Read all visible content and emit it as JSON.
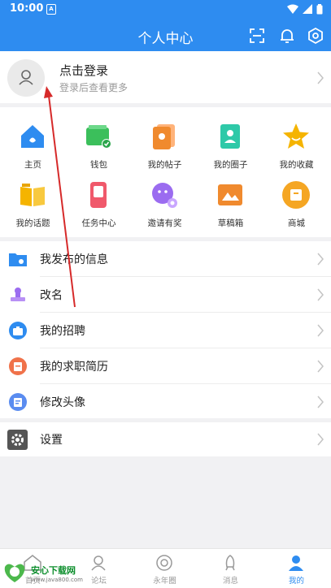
{
  "status": {
    "time": "10:00"
  },
  "header": {
    "title": "个人中心"
  },
  "login": {
    "title": "点击登录",
    "subtitle": "登录后查看更多"
  },
  "grid": [
    {
      "label": "主页",
      "icon": "home-icon",
      "color": "#2e8cf0"
    },
    {
      "label": "钱包",
      "icon": "wallet-icon",
      "color": "#3bbf5b"
    },
    {
      "label": "我的帖子",
      "icon": "posts-icon",
      "color": "#f08a2e"
    },
    {
      "label": "我的圈子",
      "icon": "circle-icon",
      "color": "#2ec9a8"
    },
    {
      "label": "我的收藏",
      "icon": "star-icon",
      "color": "#f5b400"
    },
    {
      "label": "我的话题",
      "icon": "book-icon",
      "color": "#f5b400"
    },
    {
      "label": "任务中心",
      "icon": "task-icon",
      "color": "#f0596b"
    },
    {
      "label": "邀请有奖",
      "icon": "invite-icon",
      "color": "#9b6cf0"
    },
    {
      "label": "草稿箱",
      "icon": "drafts-icon",
      "color": "#f08a2e"
    },
    {
      "label": "商城",
      "icon": "shop-icon",
      "color": "#f5a623"
    }
  ],
  "list": [
    {
      "label": "我发布的信息",
      "icon": "folder-icon"
    },
    {
      "label": "改名",
      "icon": "stamp-icon"
    },
    {
      "label": "我的招聘",
      "icon": "briefcase-icon"
    },
    {
      "label": "我的求职简历",
      "icon": "resume-icon"
    },
    {
      "label": "修改头像",
      "icon": "avatar-edit-icon"
    }
  ],
  "settings": {
    "label": "设置"
  },
  "nav": [
    {
      "label": "首页"
    },
    {
      "label": "论坛"
    },
    {
      "label": "永年圈"
    },
    {
      "label": "消息"
    },
    {
      "label": "我的"
    }
  ],
  "watermark": {
    "line1": "安心下载网",
    "line2": "www.java800.com"
  }
}
